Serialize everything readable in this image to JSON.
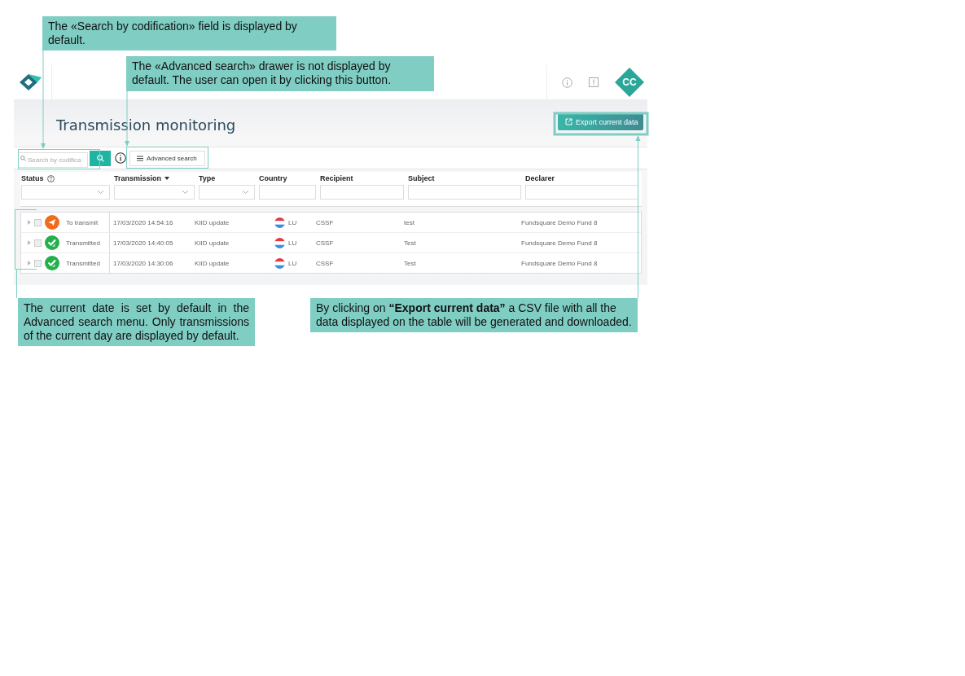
{
  "annotations": [
    {
      "kind": "top",
      "text": "The «Search by codification» field is displayed by default."
    },
    {
      "kind": "top",
      "text": "The «Advanced search» drawer is not displayed by default. The user can open it by clicking this button."
    },
    {
      "kind": "justified",
      "text": "The current date is set by default in the Advanced search menu. Only transmissions of the current day are displayed by default."
    },
    {
      "kind": "plain",
      "text": "By clicking on **“Export current data”** a CSV file with all the data displayed on the table will be generated and downloaded."
    }
  ],
  "header": {
    "avatar": "CC"
  },
  "page_title": "Transmission monitoring",
  "export_button": "Export current data",
  "search": {
    "placeholder": "Search by codifica"
  },
  "advanced_search_button": "Advanced search",
  "table": {
    "columns": [
      {
        "label": "Status",
        "kind": "select",
        "help": true,
        "sorted": false
      },
      {
        "label": "Transmission",
        "kind": "select",
        "help": false,
        "sorted": true
      },
      {
        "label": "Type",
        "kind": "select",
        "help": false,
        "sorted": false
      },
      {
        "label": "Country",
        "kind": "text",
        "help": false,
        "sorted": false
      },
      {
        "label": "Recipient",
        "kind": "text",
        "help": false,
        "sorted": false
      },
      {
        "label": "Subject",
        "kind": "text",
        "help": false,
        "sorted": false
      },
      {
        "label": "Declarer",
        "kind": "text",
        "help": false,
        "sorted": false
      }
    ],
    "rows": [
      {
        "kind": "to_transmit",
        "checked": false,
        "status": "To transmit",
        "transmission": "17/03/2020 14:54:16",
        "type": "KIID update",
        "country": "LU",
        "recipient": "CSSF",
        "subject": "test",
        "declarer": "Fundsquare Demo Fund 8"
      },
      {
        "kind": "transmitted",
        "checked": false,
        "status": "Transmitted",
        "transmission": "17/03/2020 14:40:05",
        "type": "KIID update",
        "country": "LU",
        "recipient": "CSSF",
        "subject": "Test",
        "declarer": "Fundsquare Demo Fund 8"
      },
      {
        "kind": "transmitted",
        "checked": false,
        "status": "Transmitted",
        "transmission": "17/03/2020 14:30:06",
        "type": "KIID update",
        "country": "LU",
        "recipient": "CSSF",
        "subject": "Test",
        "declarer": "Fundsquare Demo Fund 8"
      }
    ]
  }
}
